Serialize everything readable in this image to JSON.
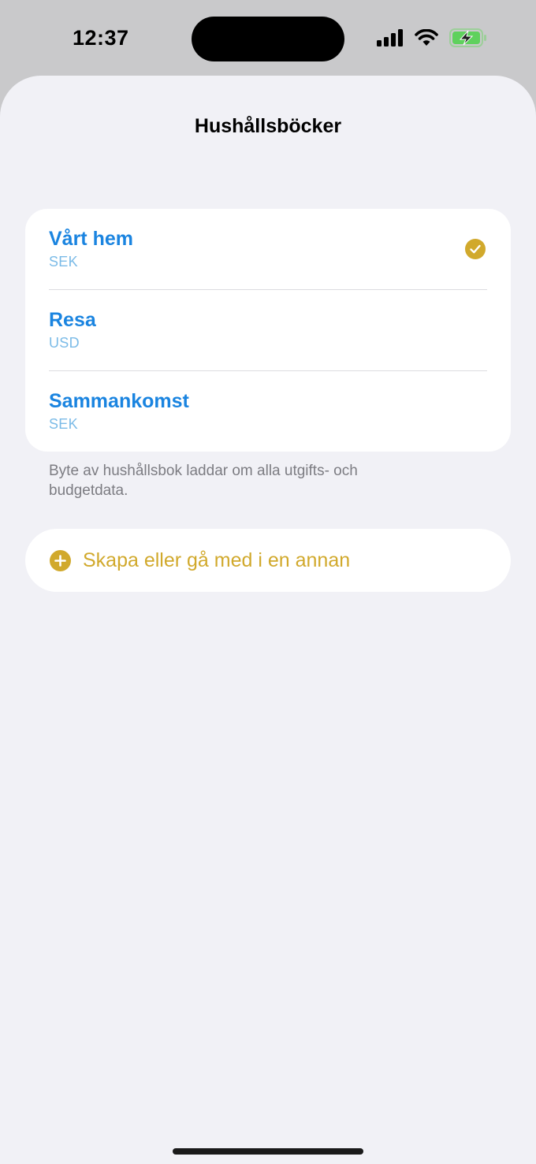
{
  "status_bar": {
    "time": "12:37"
  },
  "sheet": {
    "title": "Hushållsböcker"
  },
  "books": [
    {
      "name": "Vårt hem",
      "currency": "SEK",
      "selected": true
    },
    {
      "name": "Resa",
      "currency": "USD",
      "selected": false
    },
    {
      "name": "Sammankomst",
      "currency": "SEK",
      "selected": false
    }
  ],
  "footnote": "Byte av hushållsbok laddar om alla utgifts- och budgetdata.",
  "create_button": {
    "label": "Skapa eller gå med i en annan"
  },
  "colors": {
    "accent_blue": "#1a84e0",
    "accent_gold": "#d1a92c",
    "battery_green": "#5fd15d"
  },
  "icons": {
    "check": "checkmark-circle-icon",
    "add": "plus-circle-icon",
    "signal": "cellular-signal-icon",
    "wifi": "wifi-icon",
    "battery": "battery-charging-icon"
  }
}
